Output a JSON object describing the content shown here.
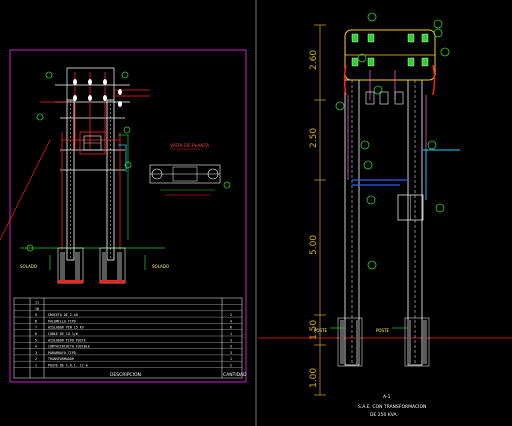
{
  "colors": {
    "background": "#000000",
    "frame_magenta": "#d020d0",
    "structure_white": "#ffffff",
    "conductor_red": "#ff2020",
    "ground_green": "#20d020",
    "callout_green": "#30d030",
    "dimension_gold": "#d8b020",
    "ground_cyan": "#20d0ff",
    "insulator_yellow": "#ffd020",
    "cable_blue": "#3060ff"
  },
  "left_sheet": {
    "detail_title": "VISTA DE PLANTA",
    "ground_label_left": "SOLADO",
    "ground_label_right": "SOLADO",
    "table_rows": [
      {
        "item": "11",
        "desc": "",
        "qty": ""
      },
      {
        "item": "10",
        "desc": "",
        "qty": ""
      },
      {
        "item": "9",
        "desc": "CRUCETA DE 2.40",
        "qty": "2"
      },
      {
        "item": "8",
        "desc": "PALOMILLA TIPO",
        "qty": "4"
      },
      {
        "item": "7",
        "desc": "AISLADOR PIN 15 KV",
        "qty": "6"
      },
      {
        "item": "6",
        "desc": "CABLE DE CU 1/0",
        "qty": "1"
      },
      {
        "item": "5",
        "desc": "AISLADOR TIPO POSTE",
        "qty": "3"
      },
      {
        "item": "4",
        "desc": "CORTACIRCUITO FUSIBLE",
        "qty": "3"
      },
      {
        "item": "3",
        "desc": "PARARRAYO TIPO",
        "qty": "3"
      },
      {
        "item": "2",
        "desc": "TRANSFORMADOR",
        "qty": "1"
      },
      {
        "item": "1",
        "desc": "POSTE DE C.A.C. 12 m",
        "qty": "2"
      }
    ],
    "table_footer_desc": "DESCRIPCION",
    "table_footer_qty": "CANTIDAD"
  },
  "right_sheet": {
    "dim_labels": [
      "2.60",
      "2.50",
      "5.00",
      "1.50",
      "1.00"
    ],
    "ground_label_left": "POSTE",
    "ground_label_right": "POSTE",
    "section_title": "A-1",
    "caption_line1": "S.A.E. CON TRANSFORMACION",
    "caption_line2": "DE 250 KVA."
  },
  "callouts": {
    "left_top": [
      "2",
      "3",
      "4"
    ],
    "left_mid": [
      "5",
      "6"
    ],
    "right_top": [
      "10",
      "11",
      "12",
      "13"
    ],
    "right_side": [
      "8",
      "9",
      "7",
      "6",
      "5",
      "4",
      "3",
      "2",
      "1"
    ]
  }
}
